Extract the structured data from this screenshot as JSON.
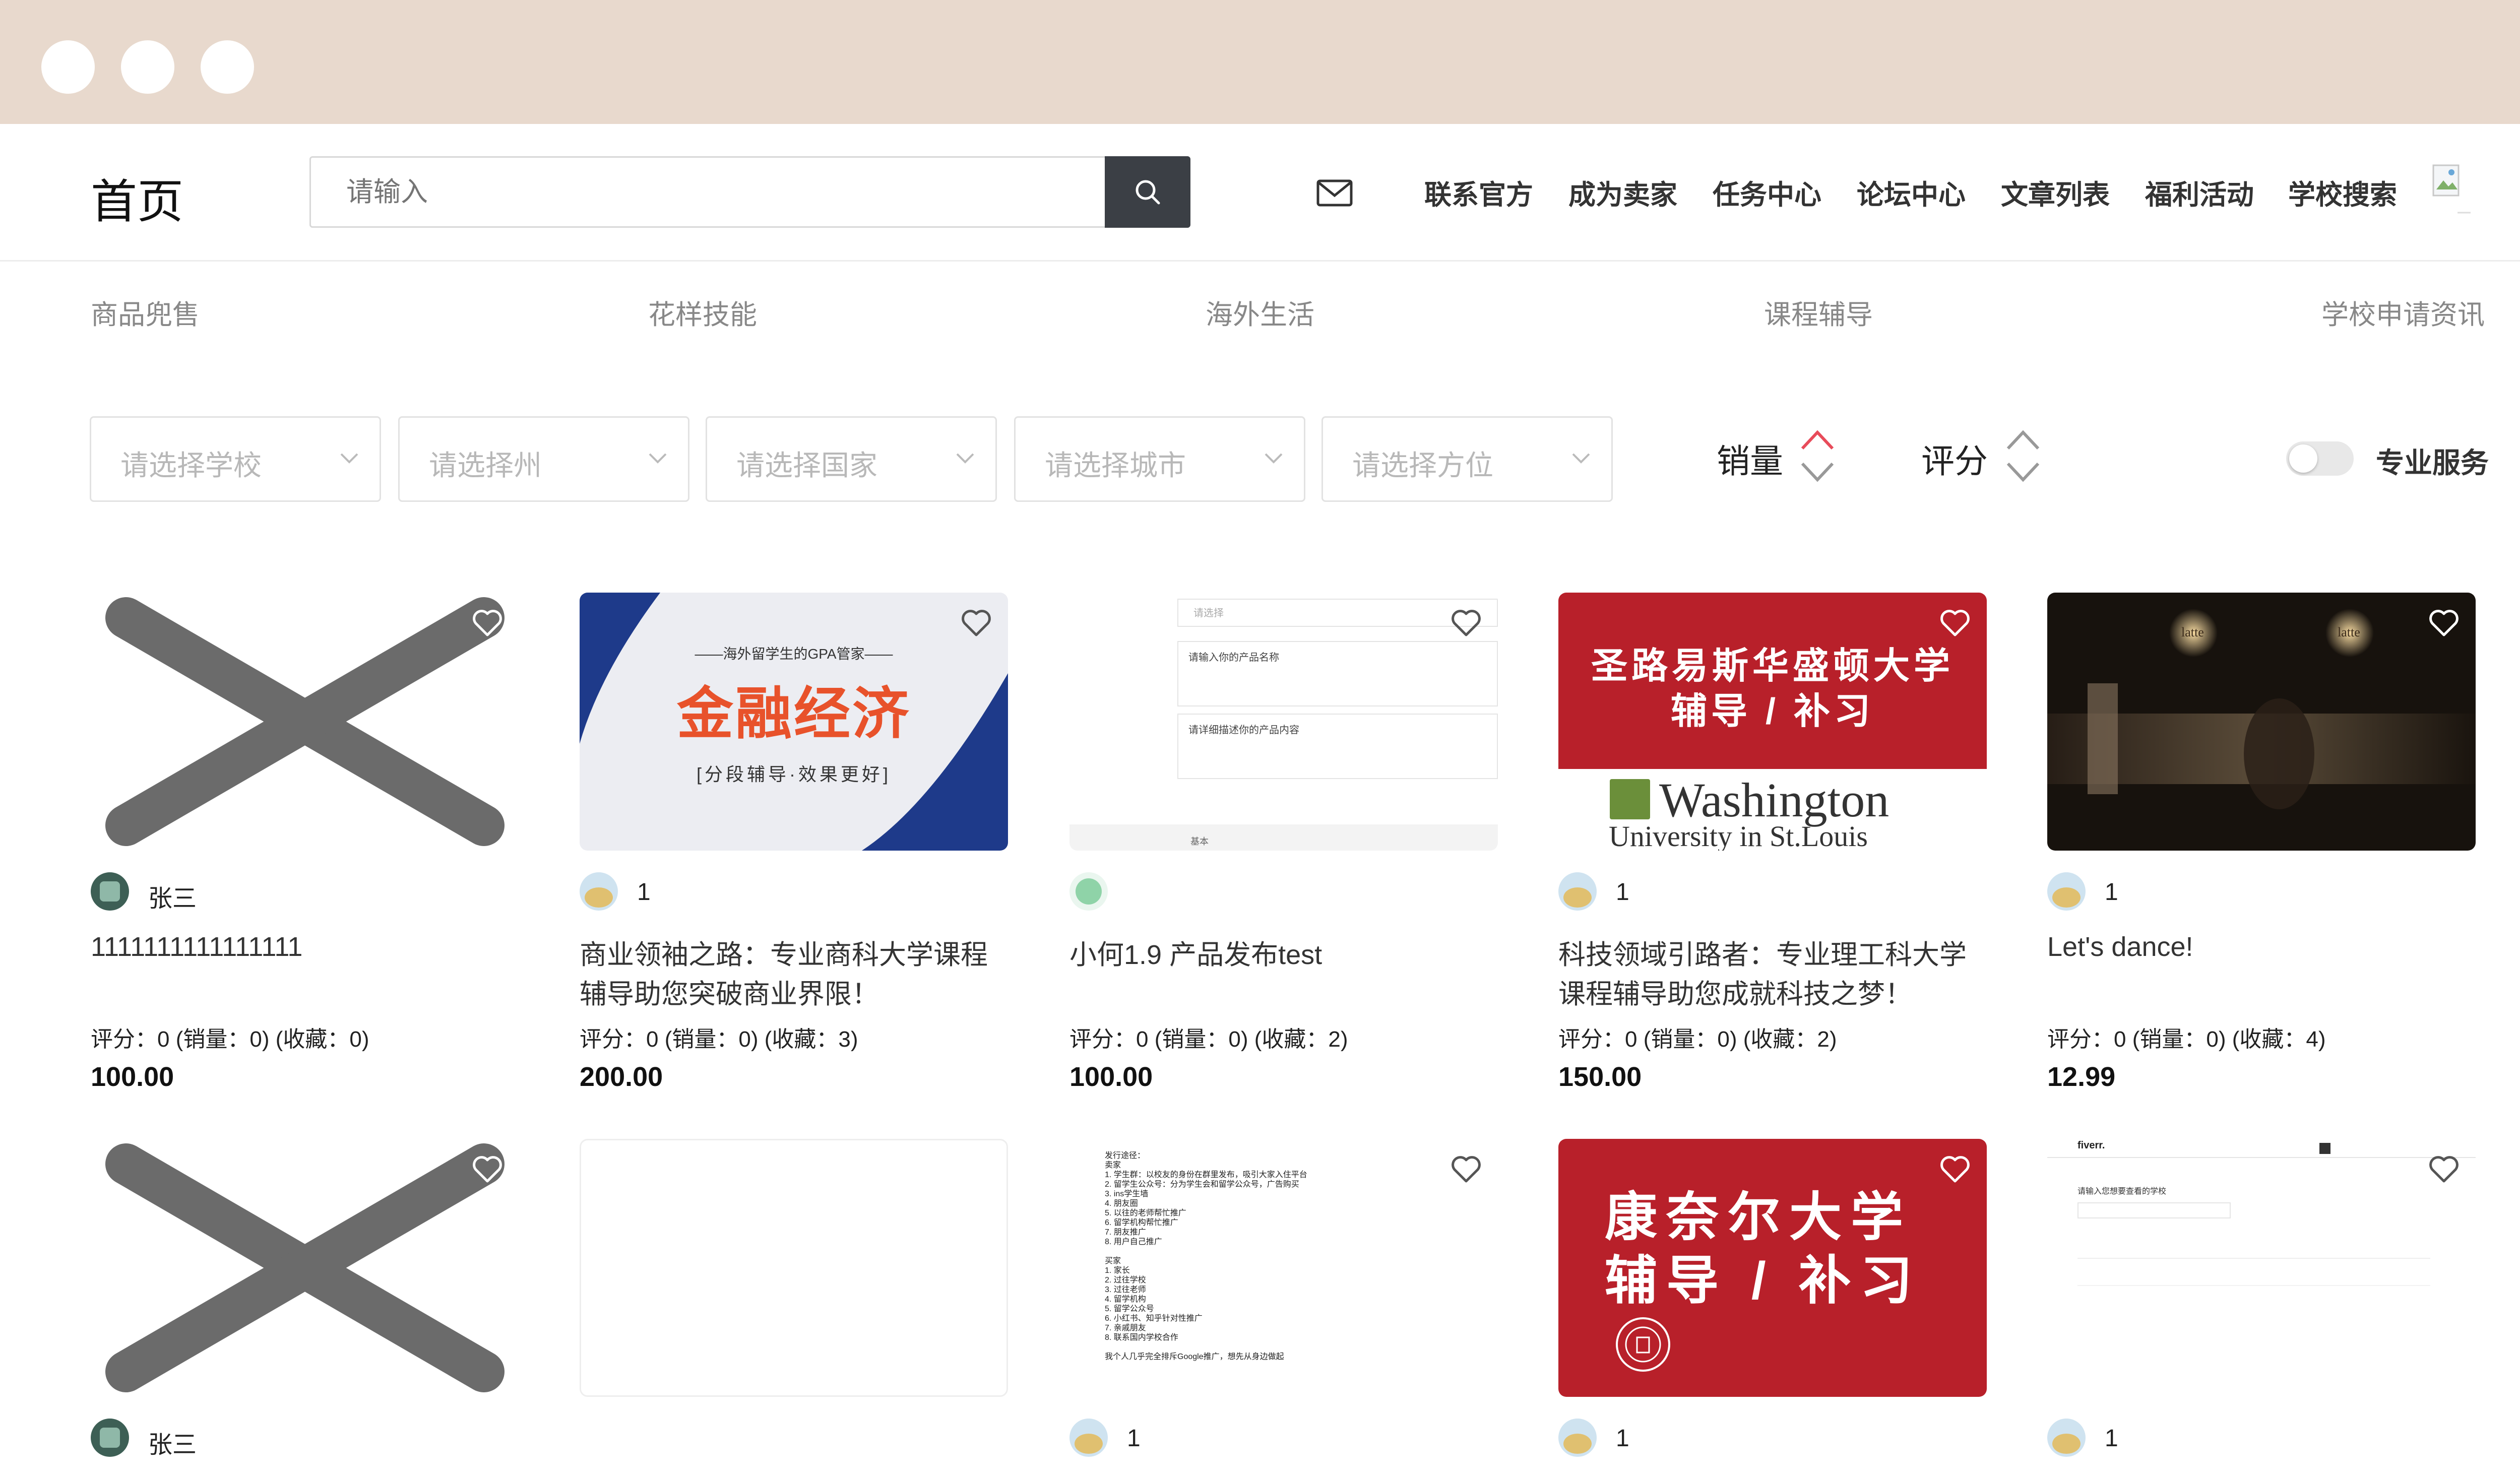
{
  "header": {
    "title": "首页",
    "search_placeholder": "请输入",
    "nav": [
      "联系官方",
      "成为卖家",
      "任务中心",
      "论坛中心",
      "文章列表",
      "福利活动",
      "学校搜索"
    ]
  },
  "categories": [
    "商品兜售",
    "花样技能",
    "海外生活",
    "课程辅导",
    "学校申请资讯"
  ],
  "filters": [
    "请选择学校",
    "请选择州",
    "请选择国家",
    "请选择城市",
    "请选择方位"
  ],
  "sort": {
    "sales": "销量",
    "rating": "评分"
  },
  "toggle": {
    "label": "专业服务",
    "on": false
  },
  "accent_color": "#e84b5a",
  "cards": [
    {
      "seller": "张三",
      "title": "1111111111111111",
      "stats": "评分：0 (销量：0) (收藏：0)",
      "price": "100.00"
    },
    {
      "seller": "1",
      "title": "商业领袖之路：专业商科大学课程辅导助您突破商业界限！",
      "stats": "评分：0 (销量：0) (收藏：3)",
      "price": "200.00",
      "thumb": {
        "small": "——海外留学生的GPA管家——",
        "big": "金融经济",
        "sub": "[分段辅导·效果更好]"
      }
    },
    {
      "seller": "",
      "title": "小何1.9 产品发布test",
      "stats": "评分：0 (销量：0) (收藏：2)",
      "price": "100.00",
      "thumb": {
        "l1": "请选择",
        "l2": "请输入你的产品名称",
        "l3": "请详细描述你的产品内容",
        "l4": "基本"
      }
    },
    {
      "seller": "1",
      "title": "科技领域引路者：专业理工科大学课程辅导助您成就科技之梦！",
      "stats": "评分：0 (销量：0) (收藏：2)",
      "price": "150.00",
      "thumb": {
        "l1": "圣路易斯华盛顿大学",
        "l2": "辅导 / 补习",
        "u1": "Washington",
        "u2": "University in St.Louis"
      }
    },
    {
      "seller": "1",
      "title": "Let's dance!",
      "stats": "评分：0 (销量：0) (收藏：4)",
      "price": "12.99",
      "thumb": {
        "s1": "latte",
        "s2": "latte"
      }
    },
    {
      "seller": "张三"
    },
    {
      "seller": ""
    },
    {
      "seller": "1",
      "thumb": {
        "lines": [
          "发行途径：",
          "卖家",
          "1. 学生群：以校友的身份在群里发布，吸引大家入住平台",
          "2. 留学生公众号：分为学生会和留学公众号，广告购买",
          "3. ins学生墙",
          "4. 朋友圈",
          "5. 以往的老师帮忙推广",
          "6. 留学机构帮忙推广",
          "7. 朋友推广",
          "8. 用户自己推广",
          "",
          "买家",
          "1. 家长",
          "2. 过往学校",
          "3. 过往老师",
          "4. 留学机构",
          "5. 留学公众号",
          "6. 小红书、知乎针对性推广",
          "7. 亲戚朋友",
          "8. 联系国内学校合作",
          "",
          "我个人几乎完全排斥Google推广，想先从身边做起"
        ]
      }
    },
    {
      "seller": "1",
      "thumb": {
        "l1": "康奈尔大学",
        "l2": "辅导 / 补习"
      }
    },
    {
      "seller": "1",
      "thumb": {
        "logo": "fiverr.",
        "l1": "请输入您想要查看的学校"
      }
    }
  ]
}
